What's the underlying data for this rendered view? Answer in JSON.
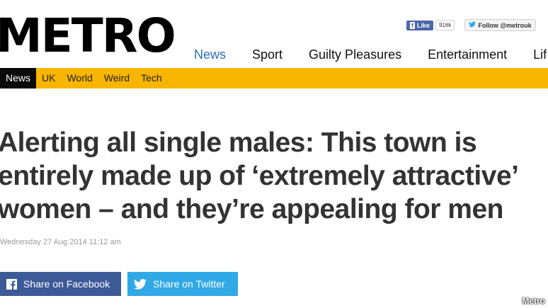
{
  "header": {
    "logo": "METRO",
    "facebook": {
      "like_label": "Like",
      "like_count": "916k"
    },
    "twitter": {
      "follow_label": "Follow @metrouk"
    }
  },
  "main_nav": [
    {
      "label": "News",
      "active": true
    },
    {
      "label": "Sport"
    },
    {
      "label": "Guilty Pleasures"
    },
    {
      "label": "Entertainment"
    },
    {
      "label": "Lif"
    }
  ],
  "sub_nav": [
    {
      "label": "News",
      "active": true
    },
    {
      "label": "UK"
    },
    {
      "label": "World"
    },
    {
      "label": "Weird"
    },
    {
      "label": "Tech"
    }
  ],
  "article": {
    "headline_lines": [
      "Alerting all single males: This town is",
      "entirely made up of ‘extremely attractive’",
      "women – and they’re appealing for men"
    ],
    "date": "Wednesday 27 Aug 2014 11:12 am"
  },
  "share": {
    "facebook_label": "Share on Facebook",
    "twitter_label": "Share on Twitter"
  },
  "watermark": "Metro",
  "colors": {
    "subnav_bg": "#f7b500",
    "nav_active": "#2d6fb8",
    "facebook": "#3d5a98",
    "twitter": "#30a9e6"
  }
}
